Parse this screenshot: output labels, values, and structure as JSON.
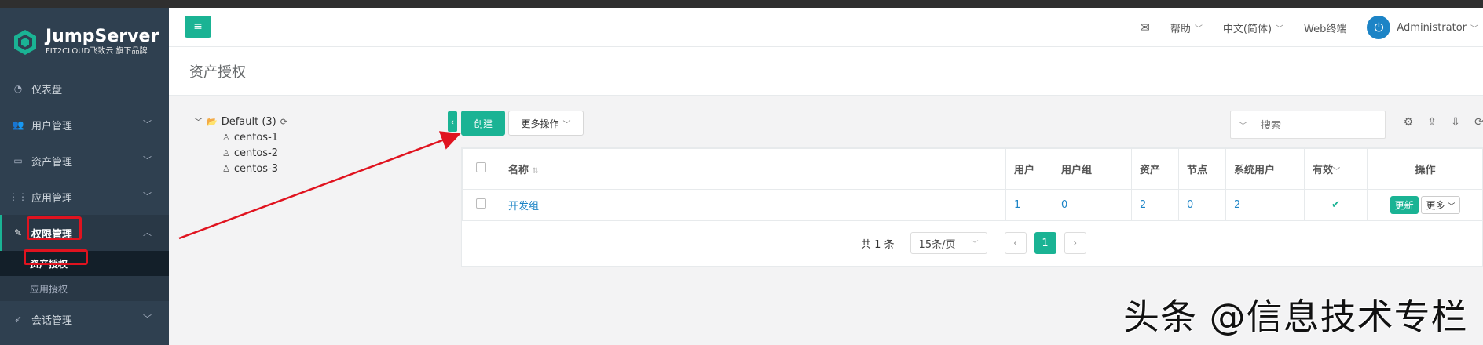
{
  "brand": {
    "name": "JumpServer",
    "tagline": "FIT2CLOUD飞致云 旗下品牌"
  },
  "sidebar": {
    "items": [
      {
        "label": "仪表盘",
        "icon": "dashboard-icon"
      },
      {
        "label": "用户管理",
        "icon": "users-icon"
      },
      {
        "label": "资产管理",
        "icon": "inbox-icon"
      },
      {
        "label": "应用管理",
        "icon": "grid-icon"
      },
      {
        "label": "权限管理",
        "icon": "edit-icon"
      },
      {
        "label": "会话管理",
        "icon": "rocket-icon"
      }
    ],
    "sub_items": [
      {
        "label": "资产授权"
      },
      {
        "label": "应用授权"
      }
    ]
  },
  "topbar": {
    "help": "帮助",
    "language": "中文(简体)",
    "web_terminal": "Web终端",
    "user": "Administrator"
  },
  "page": {
    "title": "资产授权"
  },
  "tree": {
    "root": "Default (3)",
    "children": [
      "centos-1",
      "centos-2",
      "centos-3"
    ]
  },
  "toolbar": {
    "create": "创建",
    "more_actions": "更多操作",
    "search_placeholder": "搜索"
  },
  "table": {
    "headers": [
      "名称",
      "用户",
      "用户组",
      "资产",
      "节点",
      "系统用户",
      "有效",
      "操作"
    ],
    "rows": [
      {
        "name": "开发组",
        "users": "1",
        "user_groups": "0",
        "assets": "2",
        "nodes": "0",
        "system_users": "2",
        "valid": true,
        "update": "更新",
        "more": "更多"
      }
    ]
  },
  "pagination": {
    "total": "共 1 条",
    "page_size": "15条/页",
    "current": "1"
  },
  "watermark": "头条 @信息技术专栏",
  "colors": {
    "primary": "#1ab394",
    "sidebar": "#2f4050",
    "link": "#1c84c6",
    "highlight": "#e0131f"
  }
}
